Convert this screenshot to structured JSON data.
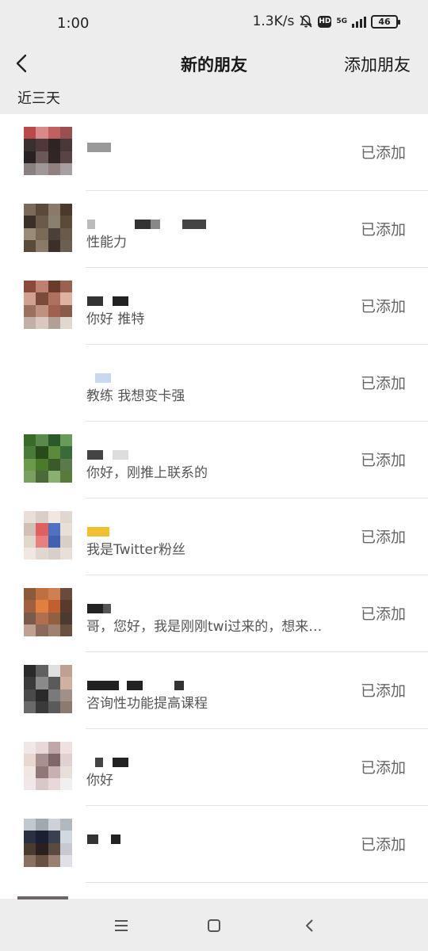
{
  "status_bar": {
    "time": "1:00",
    "network_speed": "1.3K/s",
    "hd_badge": "HD",
    "network_type": "5G",
    "battery": "46"
  },
  "nav": {
    "title": "新的朋友",
    "action": "添加朋友",
    "back_icon": "chevron-left-icon"
  },
  "section_label": "近三天",
  "items": [
    {
      "message": "",
      "status": "已添加",
      "avatar": [
        "#b84a4a",
        "#d88a8a",
        "#c06060",
        "#9a5050",
        "#3a3030",
        "#503838",
        "#2e2424",
        "#483838",
        "#2a2222",
        "#6a5858",
        "#302626",
        "#584444",
        "#8a8080",
        "#a09898",
        "#908080",
        "#a8a0a0"
      ]
    },
    {
      "message": "性能力",
      "status": "已添加",
      "avatar": [
        "#7a6a5a",
        "#5a4a3a",
        "#8a7a6a",
        "#4a3a2a",
        "#3a3028",
        "#6a5a48",
        "#8a8070",
        "#5a4a38",
        "#9a8a78",
        "#7a6a58",
        "#4a4038",
        "#6a5a4a",
        "#5a4a3a",
        "#8a7a68",
        "#3a3028",
        "#6a6050"
      ]
    },
    {
      "message": "你好 推特",
      "status": "已添加",
      "avatar": [
        "#8a4a3a",
        "#c08070",
        "#6a3a2a",
        "#9a6050",
        "#d0a090",
        "#7a4a3a",
        "#b07060",
        "#e0b0a0",
        "#9a7060",
        "#c09080",
        "#a06050",
        "#8a5a4a",
        "#c0b0a8",
        "#d8c8c0",
        "#b0a098",
        "#e0d8d0"
      ]
    },
    {
      "message": "教练 我想变卡强",
      "status": "已添加",
      "avatar": []
    },
    {
      "message": "你好，刚推上联系的",
      "status": "已添加",
      "avatar": [
        "#3a6a2a",
        "#5a8a4a",
        "#2a5a2a",
        "#6a9a5a",
        "#4a7a3a",
        "#2a4a1a",
        "#5a8a3a",
        "#3a6a3a",
        "#6a9a4a",
        "#4a7a2a",
        "#3a5a2a",
        "#5a7a4a",
        "#7aa060",
        "#4a6a3a",
        "#8ab070",
        "#5a7a3a"
      ]
    },
    {
      "message": "我是Twitter粉丝",
      "status": "已添加",
      "avatar": [
        "#e8e0d8",
        "#d8d0c8",
        "#f0e8e0",
        "#e0d8d0",
        "#d0c0b8",
        "#e06060",
        "#5070c0",
        "#e8e0d8",
        "#e0d8c8",
        "#e88080",
        "#4060b0",
        "#d8d0c8",
        "#f0e8e0",
        "#e0d8d0",
        "#d8d0c8",
        "#e8e0d8"
      ]
    },
    {
      "message": "哥，您好，我是刚刚twi过来的，想来…",
      "status": "已添加",
      "avatar": [
        "#8a5a3a",
        "#c07040",
        "#d08050",
        "#6a4a3a",
        "#a06040",
        "#e08040",
        "#c06030",
        "#5a3a2a",
        "#7a5a4a",
        "#b07050",
        "#906040",
        "#4a3a30",
        "#c0a090",
        "#8a6a5a",
        "#a08070",
        "#6a5040"
      ]
    },
    {
      "message": "咨询性功能提高课程",
      "status": "已添加",
      "avatar": [
        "#2a2a2a",
        "#606060",
        "#e0e0e0",
        "#c0a090",
        "#3a3a3a",
        "#8a8a8a",
        "#5a5a5a",
        "#d0b0a0",
        "#4a4a4a",
        "#2a2a2a",
        "#7a7a7a",
        "#a09088",
        "#6a6a6a",
        "#3a3a3a",
        "#5a5a5a",
        "#8a7a70"
      ]
    },
    {
      "message": "你好",
      "status": "已添加",
      "avatar": [
        "#f0e8e8",
        "#e8d8d8",
        "#c0a8a8",
        "#f0e0e0",
        "#e8d8d0",
        "#a89090",
        "#806868",
        "#e0d0d0",
        "#f0e8e0",
        "#907878",
        "#c8b0b0",
        "#e8e0d8",
        "#f0e8e8",
        "#d8c8c8",
        "#e8d8d8",
        "#f0f0f0"
      ]
    },
    {
      "message": "",
      "status": "已添加",
      "avatar": [
        "#c0c8d0",
        "#a0a8b0",
        "#d0d0d8",
        "#b0b8c0",
        "#2a3040",
        "#1a2030",
        "#3a4050",
        "#d0d8e0",
        "#4a3a30",
        "#2a2020",
        "#5a4a40",
        "#c8c8d0",
        "#8a7060",
        "#6a5040",
        "#9a8070",
        "#e0e0e8"
      ]
    }
  ],
  "system_nav": {
    "menu_icon": "menu-icon",
    "home_icon": "home-square-icon",
    "back_icon": "back-triangle-icon"
  }
}
